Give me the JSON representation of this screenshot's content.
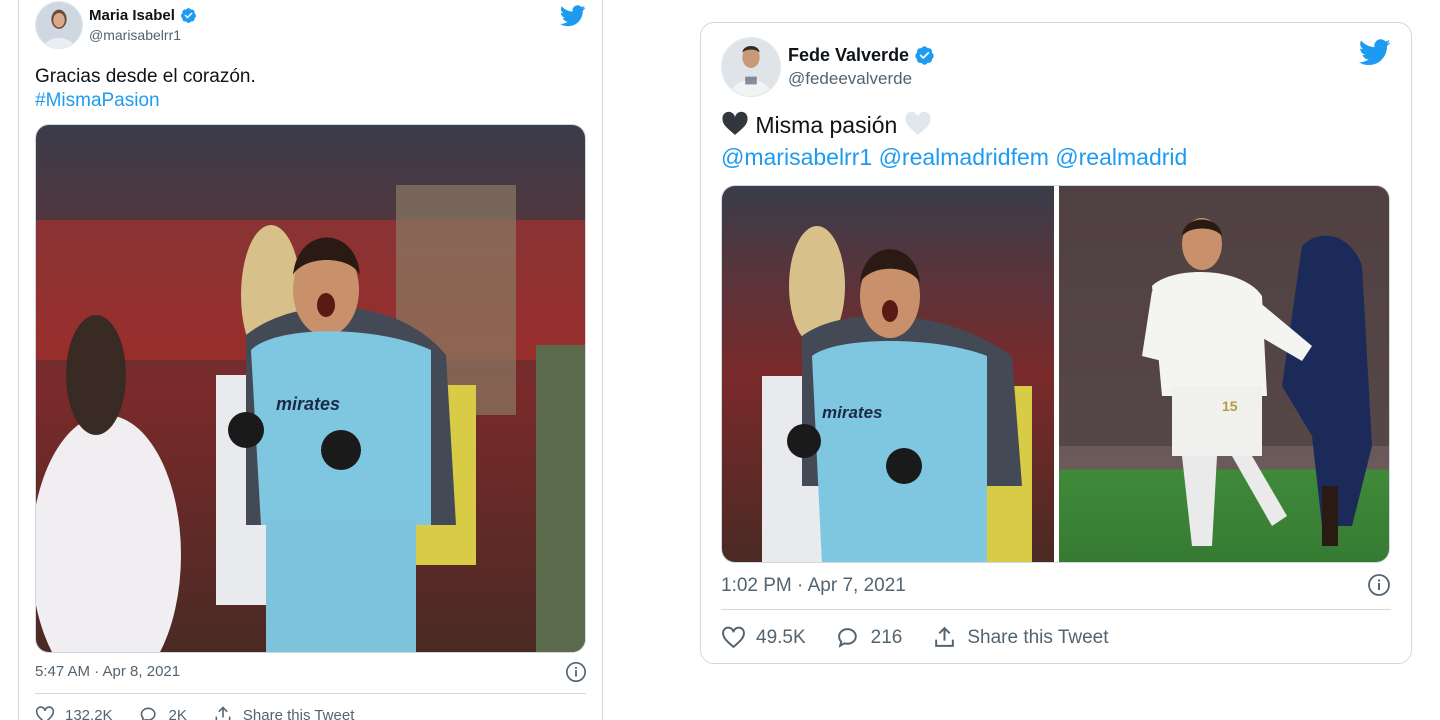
{
  "tweets": [
    {
      "author": {
        "name": "Maria Isabel",
        "handle": "@marisabelrr1",
        "verified": true
      },
      "text_line1": "Gracias desde el corazón.",
      "hashtag": "#MismaPasion",
      "images": [
        "goalkeeper-celebrating-photo"
      ],
      "timestamp": "5:47 AM · Apr 8, 2021",
      "likes": "132.2K",
      "replies": "2K",
      "share_label": "Share this Tweet"
    },
    {
      "author": {
        "name": "Fede Valverde",
        "handle": "@fedeevalverde",
        "verified": true
      },
      "text_emoji_left": "black-heart",
      "text_main": "Misma pasión",
      "text_emoji_right": "white-heart",
      "mentions": [
        "@marisabelrr1",
        "@realmadridfem",
        "@realmadrid"
      ],
      "images": [
        "goalkeeper-celebrating-photo",
        "valverde-celebrating-photo"
      ],
      "timestamp": "1:02 PM · Apr 7, 2021",
      "likes": "49.5K",
      "replies": "216",
      "share_label": "Share this Tweet"
    }
  ],
  "colors": {
    "twitter_blue": "#1d9bf0",
    "text_primary": "#0f1419",
    "text_secondary": "#536471",
    "border": "#cfd9de"
  }
}
